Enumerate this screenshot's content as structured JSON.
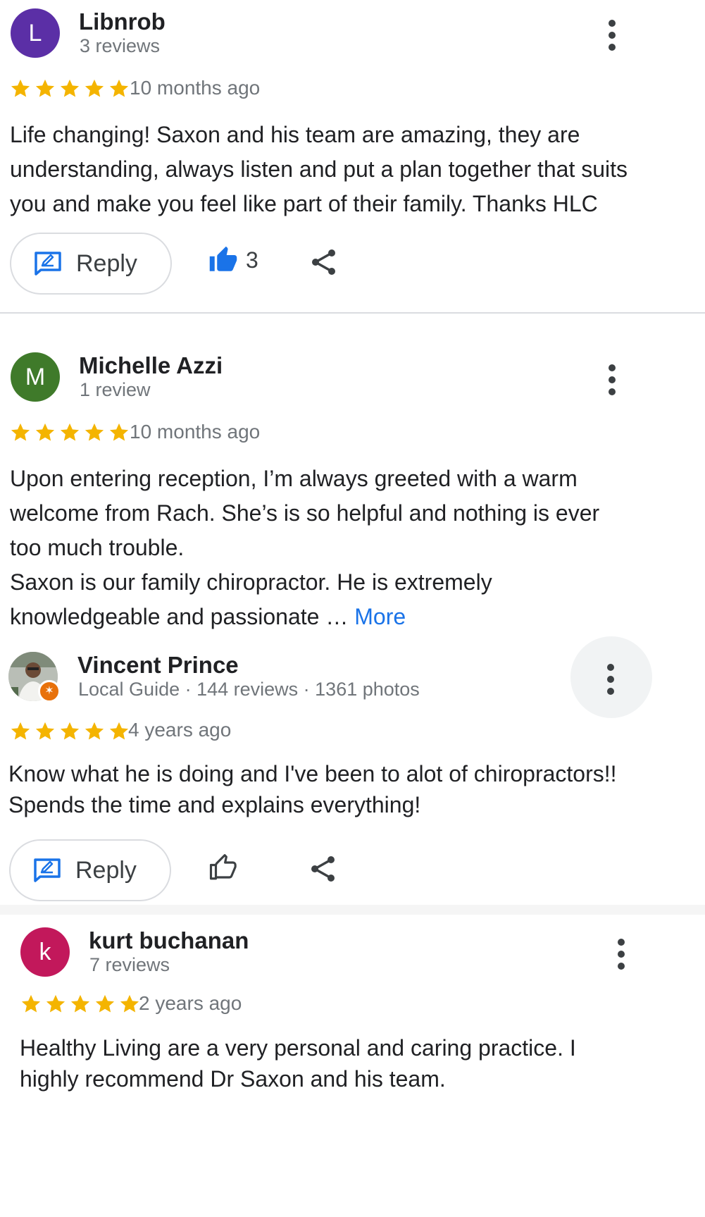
{
  "colors": {
    "star": "#f4b400",
    "link": "#1a73e8",
    "like_filled": "#1a73e8",
    "avatar_libnrob": "#5b2fa6",
    "avatar_michelle": "#3f7a2a",
    "avatar_kurt": "#c2185b"
  },
  "reviews": [
    {
      "avatar_letter": "L",
      "name": "Libnrob",
      "meta": "3 reviews",
      "rating": 5,
      "time_ago": "10 months ago",
      "text": [
        "Life changing! Saxon and his team are amazing, they are understanding, always listen and put a plan together that suits you and make you feel like part of their family. Thanks HLC"
      ],
      "reply_label": "Reply",
      "like_count": "3",
      "like_icon": "thumb-up-filled-icon"
    },
    {
      "avatar_letter": "M",
      "name": "Michelle Azzi",
      "meta": "1 review",
      "rating": 5,
      "time_ago": "10 months ago",
      "text": [
        "Upon entering reception, I’m always greeted with a warm welcome from Rach. She’s is so helpful and nothing is ever too much trouble.",
        "Saxon is our family chiropractor. He is extremely knowledgeable and passionate … "
      ],
      "more_label": "More"
    },
    {
      "avatar_icon": "user-photo-avatar",
      "name": "Vincent Prince",
      "meta": "Local Guide · 144 reviews · 1361 photos",
      "rating": 5,
      "time_ago": "4 years ago",
      "text": [
        "Know what he is doing and I've been to alot of chiropractors!! Spends the time and explains everything!"
      ],
      "reply_label": "Reply",
      "like_icon": "thumb-up-outline-icon"
    },
    {
      "avatar_letter": "k",
      "name": "kurt buchanan",
      "meta": "7 reviews",
      "rating": 5,
      "time_ago": "2 years ago",
      "text": [
        "Healthy Living are a very personal and caring practice. I highly recommend Dr Saxon and his team."
      ]
    }
  ]
}
